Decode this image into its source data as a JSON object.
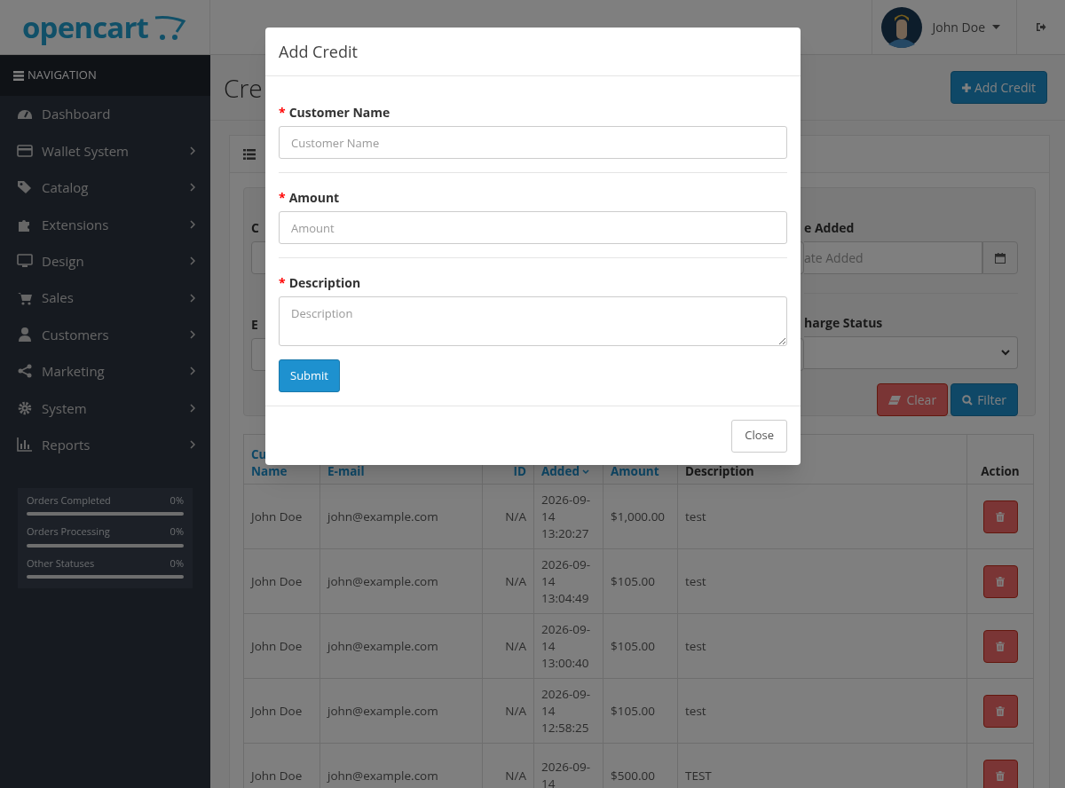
{
  "header": {
    "logo": "opencart",
    "user": "John Doe"
  },
  "sidebar": {
    "title": "NAVIGATION",
    "items": [
      {
        "label": "Dashboard",
        "kind": "gauge",
        "submenu": false
      },
      {
        "label": "Wallet System",
        "kind": "card",
        "submenu": true
      },
      {
        "label": "Catalog",
        "kind": "tag",
        "submenu": true
      },
      {
        "label": "Extensions",
        "kind": "puzzle",
        "submenu": true
      },
      {
        "label": "Design",
        "kind": "monitor",
        "submenu": true
      },
      {
        "label": "Sales",
        "kind": "cart",
        "submenu": true
      },
      {
        "label": "Customers",
        "kind": "user",
        "submenu": true
      },
      {
        "label": "Marketing",
        "kind": "share",
        "submenu": true
      },
      {
        "label": "System",
        "kind": "gear",
        "submenu": true
      },
      {
        "label": "Reports",
        "kind": "chart",
        "submenu": true
      }
    ],
    "stats": [
      {
        "label": "Orders Completed",
        "value": "0%"
      },
      {
        "label": "Orders Processing",
        "value": "0%"
      },
      {
        "label": "Other Statuses",
        "value": "0%"
      }
    ]
  },
  "page": {
    "title": "Cre",
    "add_button": "Add Credit"
  },
  "filter": {
    "left_labels": [
      "C",
      "E"
    ],
    "date_label": "e Added",
    "date_placeholder": "ate Added",
    "status_label": "harge Status",
    "clear": "Clear",
    "filter": "Filter"
  },
  "table": {
    "columns": [
      {
        "lines": [
          "Cu",
          "Name"
        ],
        "link": true,
        "sorted": false
      },
      {
        "lines": [
          "E-mail"
        ],
        "link": true,
        "sorted": false
      },
      {
        "lines": [
          "ID"
        ],
        "link": true,
        "sorted": false
      },
      {
        "lines": [
          "Added"
        ],
        "link": true,
        "sorted": true
      },
      {
        "lines": [
          "Amount"
        ],
        "link": true,
        "sorted": false
      },
      {
        "lines": [
          "Description"
        ],
        "link": false
      },
      {
        "lines": [
          "Action"
        ],
        "link": false
      }
    ],
    "rows": [
      {
        "name": "John Doe",
        "email": "john@example.com",
        "id": "N/A",
        "date": "2026-09-14 13:20:27",
        "amount": "$1,000.00",
        "description": "test"
      },
      {
        "name": "John Doe",
        "email": "john@example.com",
        "id": "N/A",
        "date": "2026-09-14 13:04:49",
        "amount": "$105.00",
        "description": "test"
      },
      {
        "name": "John Doe",
        "email": "john@example.com",
        "id": "N/A",
        "date": "2026-09-14 13:00:40",
        "amount": "$105.00",
        "description": "test"
      },
      {
        "name": "John Doe",
        "email": "john@example.com",
        "id": "N/A",
        "date": "2026-09-14 12:58:25",
        "amount": "$105.00",
        "description": "test"
      },
      {
        "name": "John Doe",
        "email": "john@example.com",
        "id": "N/A",
        "date": "2026-09-14",
        "amount": "$500.00",
        "description": "TEST"
      }
    ]
  },
  "modal": {
    "title": "Add Credit",
    "fields": [
      {
        "mark": "*",
        "label": "Customer Name",
        "placeholder": "Customer Name",
        "kind": "input"
      },
      {
        "mark": "*",
        "label": "Amount",
        "placeholder": "Amount",
        "kind": "input"
      },
      {
        "mark": "*",
        "label": "Description",
        "placeholder": "Description",
        "kind": "textarea"
      }
    ],
    "submit": "Submit",
    "close": "Close"
  }
}
